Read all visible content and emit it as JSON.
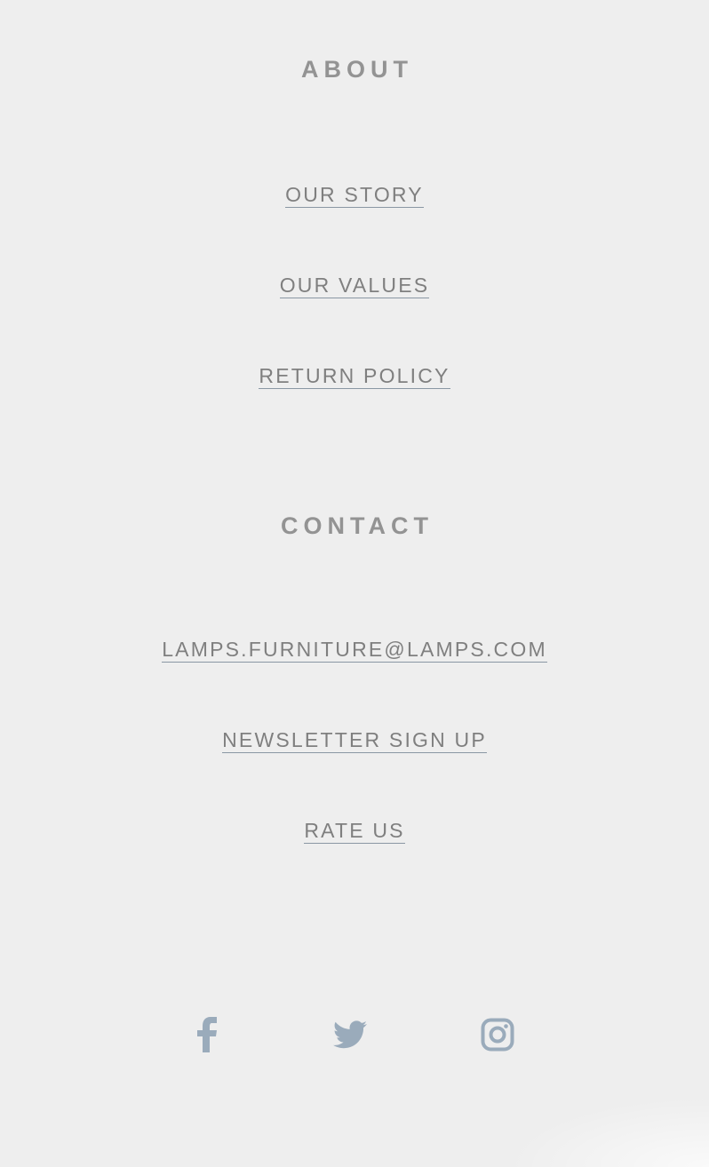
{
  "about": {
    "heading": "ABOUT",
    "links": [
      {
        "label": "OUR STORY"
      },
      {
        "label": "OUR VALUES"
      },
      {
        "label": "RETURN POLICY"
      }
    ]
  },
  "contact": {
    "heading": "CONTACT",
    "links": [
      {
        "label": "LAMPS.FURNITURE@LAMPS.COM"
      },
      {
        "label": "NEWSLETTER SIGN UP"
      },
      {
        "label": "RATE US"
      }
    ]
  },
  "social": {
    "icons": [
      "facebook-icon",
      "twitter-icon",
      "instagram-icon"
    ],
    "icon_color": "#9aabbb"
  },
  "colors": {
    "background": "#eeeeee",
    "heading": "#939393",
    "link": "#7f7f7f",
    "link_underline": "#8a97a3"
  }
}
